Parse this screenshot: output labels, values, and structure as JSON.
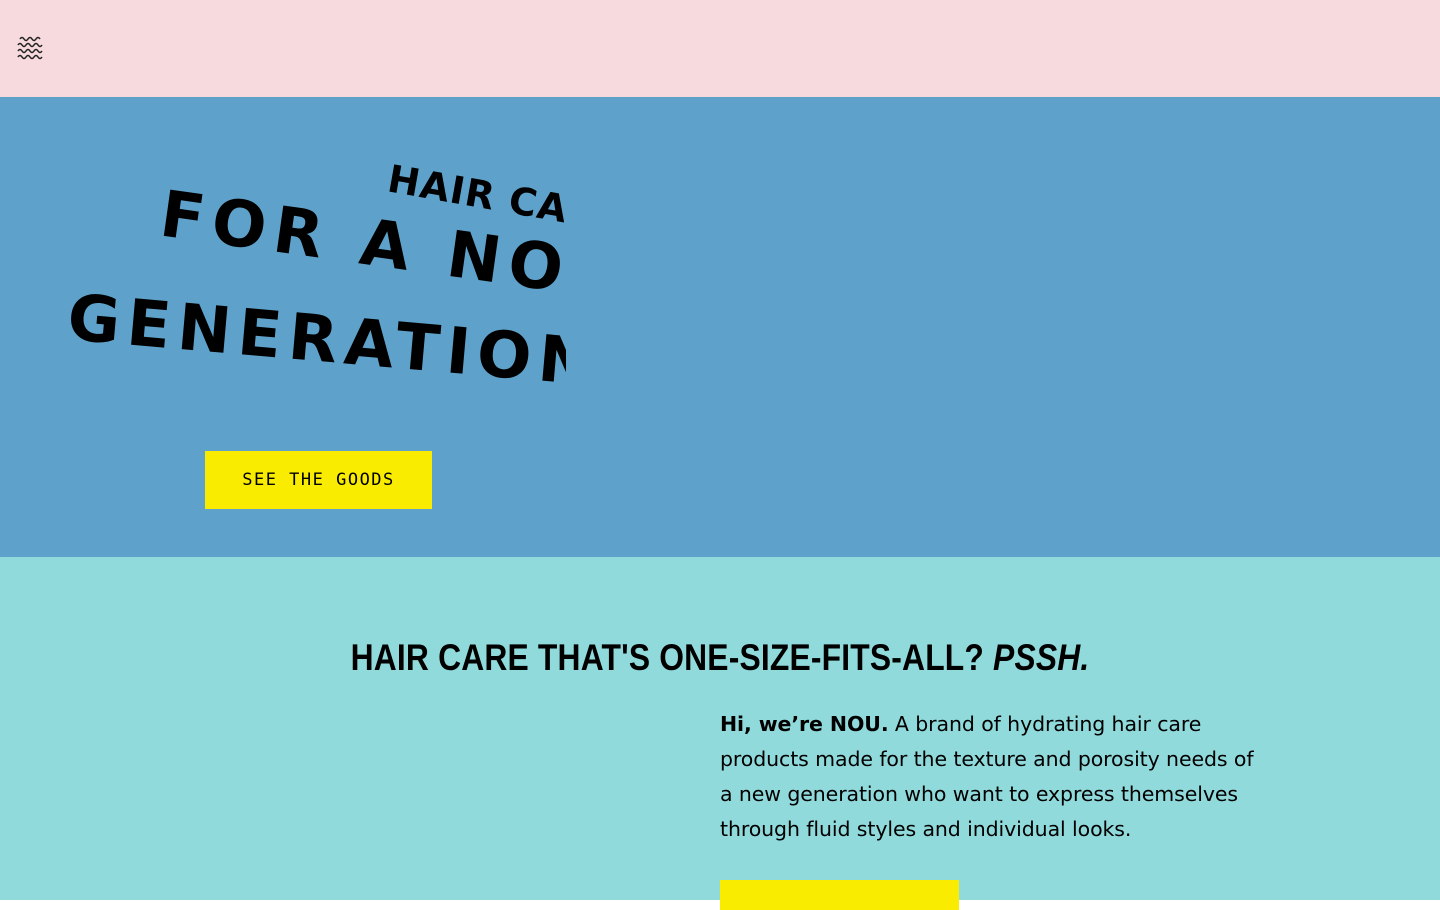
{
  "header": {
    "menu_icon": "waves-menu-icon"
  },
  "hero": {
    "logo": {
      "line1": "HAIR CARE",
      "line2": "FOR A NOU",
      "line3": "GENERATION"
    },
    "cta_label": "SEE THE GOODS"
  },
  "about": {
    "heading_main": "HAIR CARE THAT'S ONE-SIZE-FITS-ALL? ",
    "heading_emphasis": "PSSH.",
    "intro_bold": "Hi, we’re NOU.",
    "intro_body": " A brand of hydrating hair care products made for the texture and porosity needs of a new generation who want to express themselves through fluid styles and individual looks."
  },
  "colors": {
    "topbar": "#f6dade",
    "hero": "#5ea2cb",
    "about": "#90dadc",
    "button": "#f9ec00",
    "text": "#000000"
  }
}
